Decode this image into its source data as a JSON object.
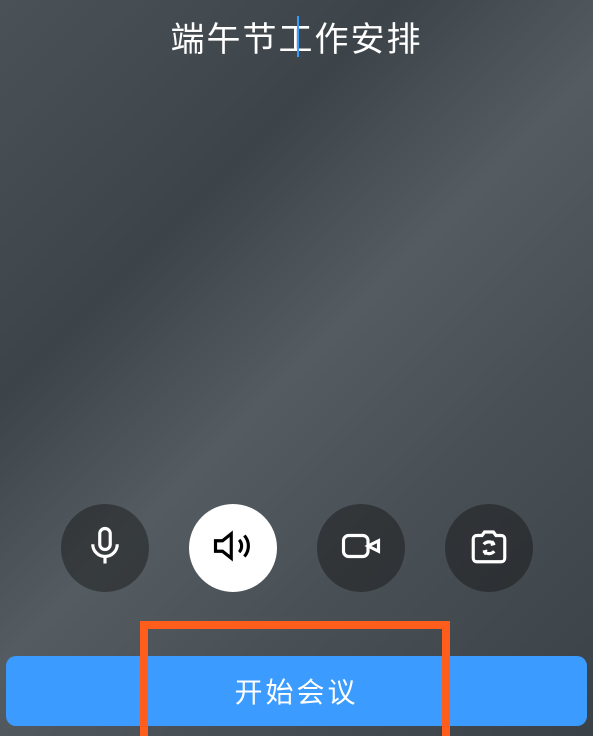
{
  "meeting": {
    "title": "端午节工作安排"
  },
  "controls": {
    "mic_icon": "microphone-icon",
    "speaker_icon": "speaker-icon",
    "video_icon": "video-icon",
    "camera_switch_icon": "camera-switch-icon"
  },
  "actions": {
    "start_label": "开始会议"
  },
  "colors": {
    "accent": "#3b9bff",
    "highlight": "#ff5d1b"
  }
}
